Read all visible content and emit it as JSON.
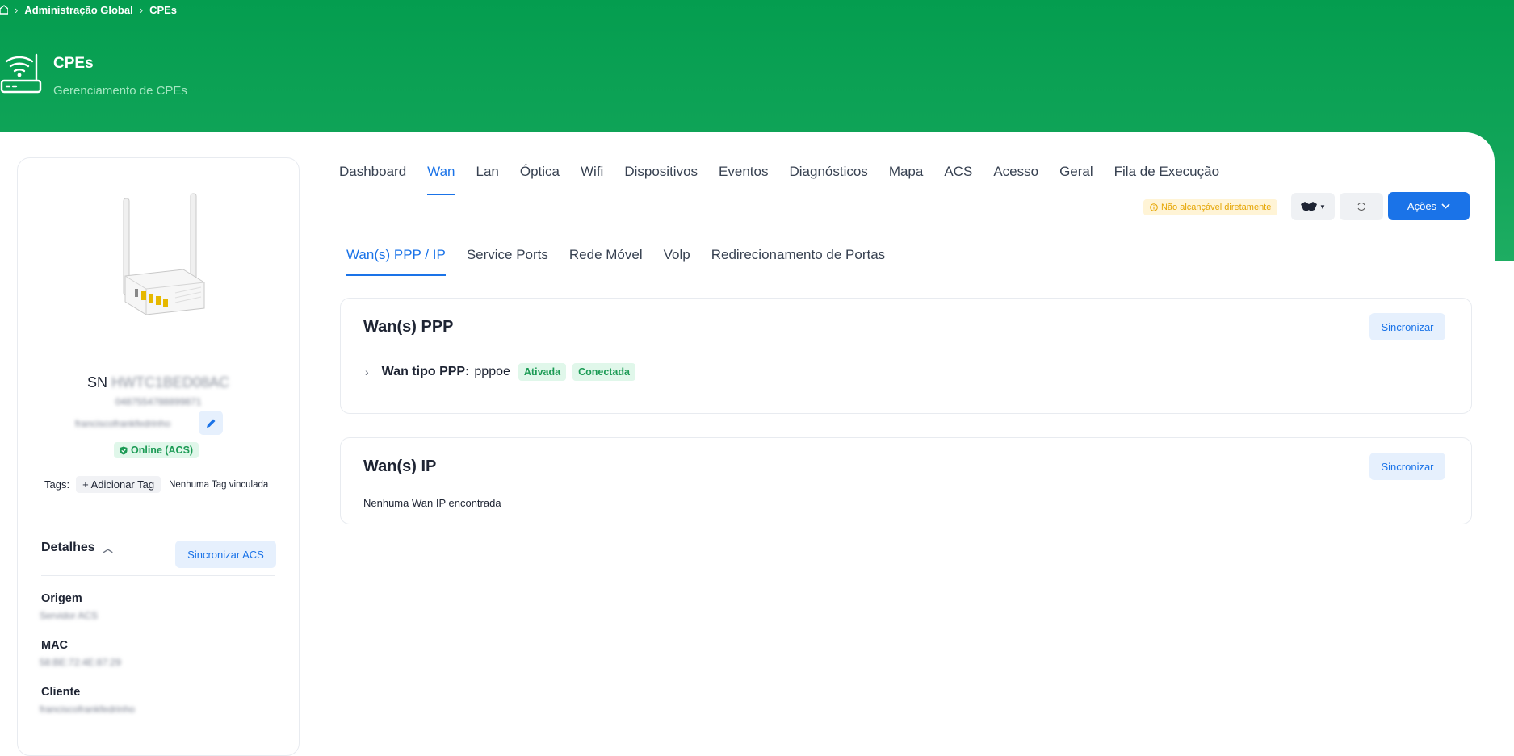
{
  "breadcrumb": {
    "items": [
      "Administração Global",
      "CPEs"
    ]
  },
  "header": {
    "title": "CPEs",
    "subtitle": "Gerenciamento de CPEs"
  },
  "device": {
    "sn_prefix": "SN",
    "sn_value": "HWTC1BED08AC",
    "line2": "0487554788899871",
    "line3": "franciscofrankfedrinho",
    "status": "Online (ACS)",
    "tags_label": "Tags:",
    "add_tag": "+ Adicionar Tag",
    "no_tags": "Nenhuma Tag vinculada"
  },
  "details": {
    "title": "Detalhes",
    "sync_label": "Sincronizar ACS",
    "fields": [
      {
        "label": "Origem",
        "value": "Servidor ACS"
      },
      {
        "label": "MAC",
        "value": "58:BE:72:4E:87:29"
      },
      {
        "label": "Cliente",
        "value": "franciscofrankfedrinho"
      }
    ]
  },
  "tabs": [
    "Dashboard",
    "Wan",
    "Lan",
    "Óptica",
    "Wifi",
    "Dispositivos",
    "Eventos",
    "Diagnósticos",
    "Mapa",
    "ACS",
    "Acesso",
    "Geral",
    "Fila de Execução"
  ],
  "active_tab": "Wan",
  "toolbar": {
    "status_chip": "Não alcançável diretamente",
    "actions_label": "Ações"
  },
  "subtabs": [
    "Wan(s) PPP / IP",
    "Service Ports",
    "Rede Móvel",
    "Volp",
    "Redirecionamento de Portas"
  ],
  "active_subtab": "Wan(s) PPP / IP",
  "wan_ppp": {
    "title": "Wan(s) PPP",
    "sync_label": "Sincronizar",
    "row_label": "Wan tipo PPP:",
    "row_value": "pppoe",
    "badge_enabled": "Ativada",
    "badge_connected": "Conectada"
  },
  "wan_ip": {
    "title": "Wan(s) IP",
    "sync_label": "Sincronizar",
    "empty": "Nenhuma Wan IP encontrada"
  },
  "colors": {
    "brand_green": "#049d4f",
    "primary_blue": "#1a73e8",
    "success": "#1c9b55",
    "warning": "#e5a400"
  }
}
